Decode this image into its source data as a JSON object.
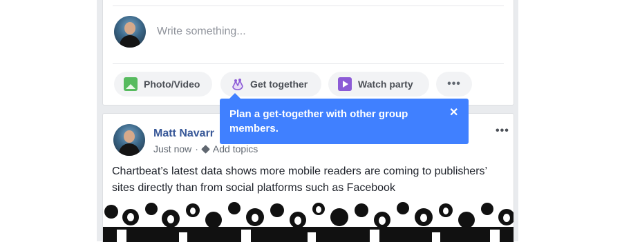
{
  "composer": {
    "placeholder": "Write something...",
    "actions": [
      {
        "label": "Photo/Video",
        "icon": "photo-icon"
      },
      {
        "label": "Get together",
        "icon": "get-together-icon"
      },
      {
        "label": "Watch party",
        "icon": "watch-party-icon"
      }
    ],
    "more": "•••"
  },
  "tooltip": {
    "text": "Plan a get-together with other group members.",
    "close": "✕"
  },
  "post": {
    "author": "Matt Navarr",
    "time": "Just now",
    "separator": "·",
    "add_topics": "Add topics",
    "more": "•••",
    "body": "Chartbeat’s latest data shows more mobile readers are coming to publishers’ sites directly than from social platforms such as Facebook"
  },
  "colors": {
    "accent": "#4080ff",
    "link": "#385898",
    "feed_bg": "#e9ebee"
  }
}
